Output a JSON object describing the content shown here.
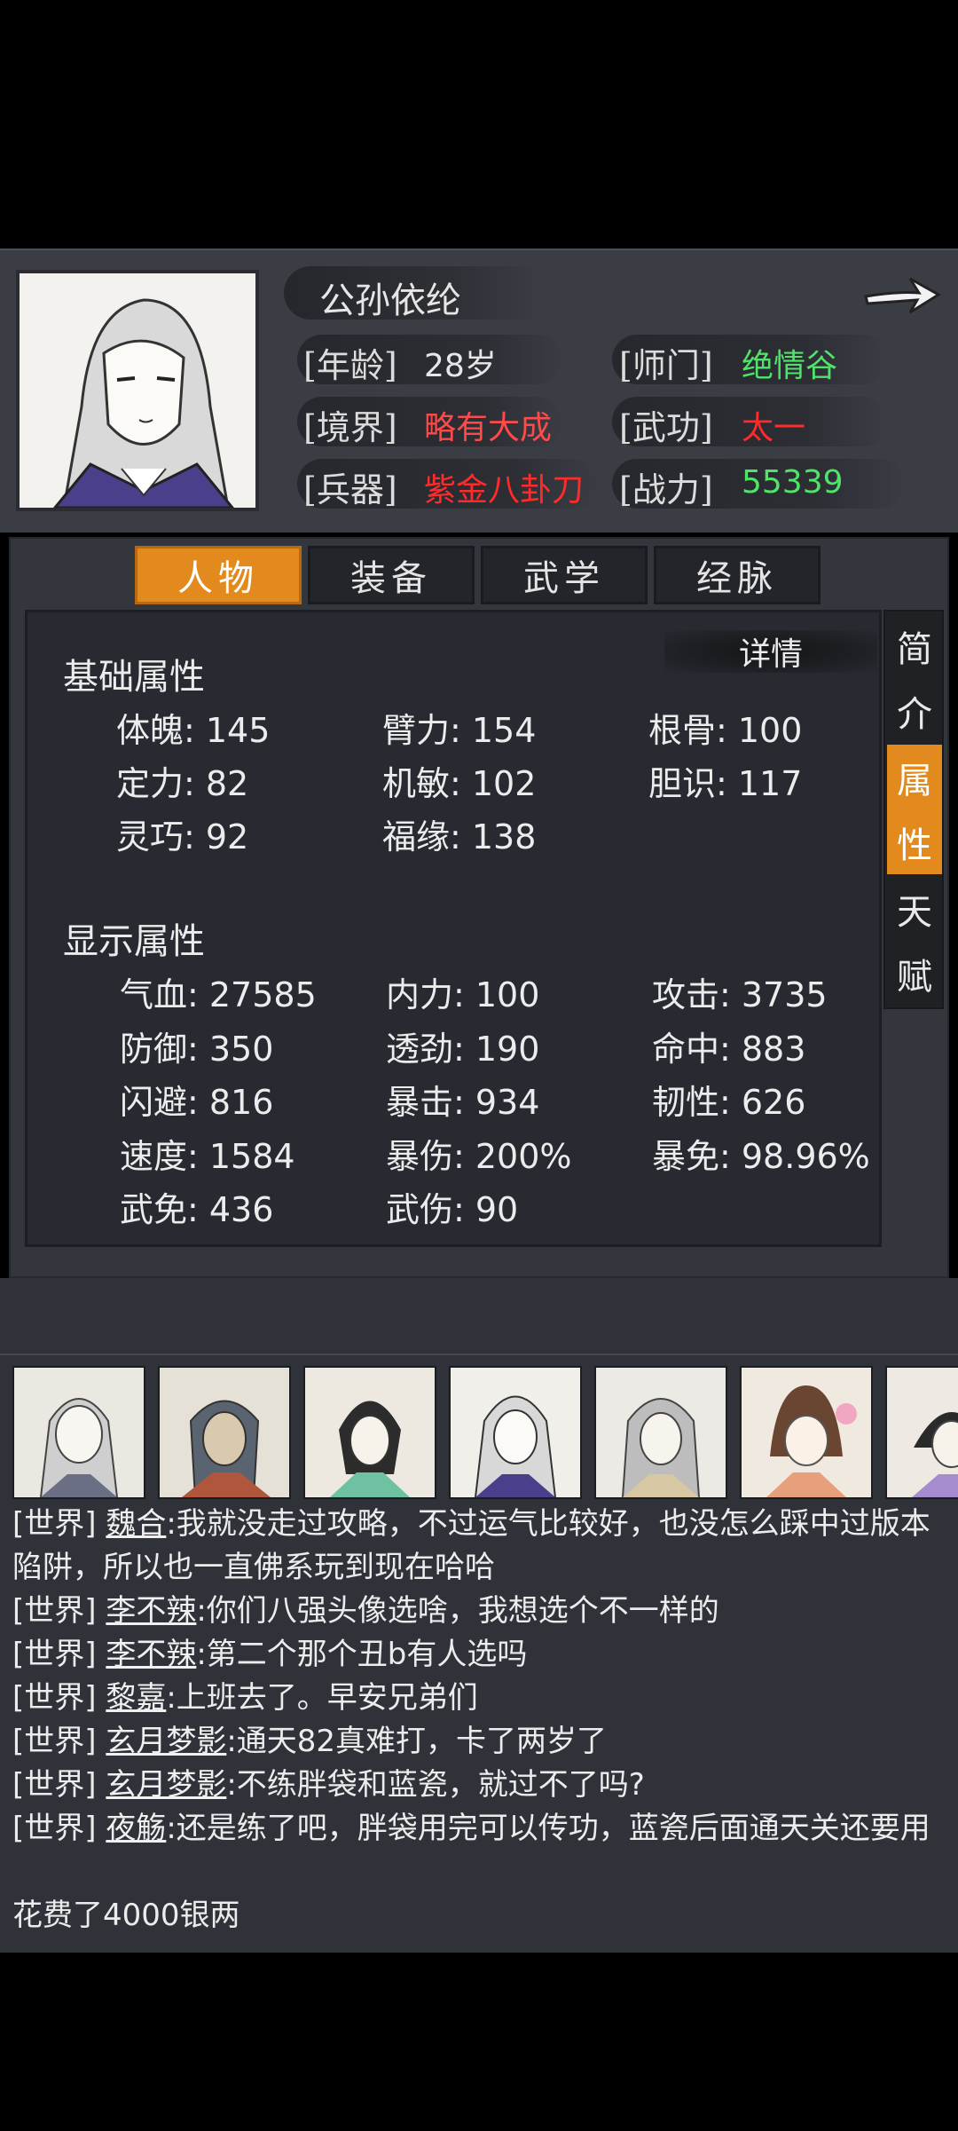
{
  "character": {
    "name": "公孙依纶",
    "rows": [
      {
        "label": "[年龄]",
        "value": "28岁",
        "color": "#e6e6e6"
      },
      {
        "label": "[境界]",
        "value": "略有大成",
        "color": "#ff4a4a"
      },
      {
        "label": "[兵器]",
        "value": "紫金八卦刀",
        "color": "#ff2a2a"
      }
    ],
    "rows_right": [
      {
        "label": "[师门]",
        "value": "绝情谷",
        "color": "#4fe36a"
      },
      {
        "label": "[武功]",
        "value": "太一",
        "color": "#ff2a2a"
      },
      {
        "label": "[战力]",
        "value": "55339",
        "color": "#4fe36a"
      }
    ]
  },
  "tabs": [
    "人物",
    "装备",
    "武学",
    "经脉"
  ],
  "side_tabs": [
    [
      "简",
      "介"
    ],
    [
      "属",
      "性"
    ],
    [
      "天",
      "赋"
    ]
  ],
  "detail_label": "详情",
  "base": {
    "title": "基础属性",
    "stats": [
      "体魄: 145",
      "臂力: 154",
      "根骨: 100",
      "定力: 82",
      "机敏: 102",
      "胆识: 117",
      "灵巧: 92",
      "福缘: 138"
    ]
  },
  "display": {
    "title": "显示属性",
    "stats": [
      "气血: 27585",
      "内力: 100",
      "攻击: 3735",
      "防御: 350",
      "透劲: 190",
      "命中: 883",
      "闪避: 816",
      "暴击: 934",
      "韧性: 626",
      "速度: 1584",
      "暴伤: 200%",
      "暴免: 98.96%",
      "武免: 436",
      "武伤: 90"
    ]
  },
  "chat": {
    "messages": [
      {
        "channel": "[世界]",
        "who": "魏合",
        "text": ":我就没走过攻略，不过运气比较好，也没怎么踩中过版本陷阱，所以也一直佛系玩到现在哈哈"
      },
      {
        "channel": "[世界]",
        "who": "李不辣",
        "text": ":你们八强头像选啥，我想选个不一样的"
      },
      {
        "channel": "[世界]",
        "who": "李不辣",
        "text": ":第二个那个丑b有人选吗"
      },
      {
        "channel": "[世界]",
        "who": "黎嘉",
        "text": ":上班去了。早安兄弟们"
      },
      {
        "channel": "[世界]",
        "who": "玄月梦影",
        "text": ":通天82真难打，卡了两岁了"
      },
      {
        "channel": "[世界]",
        "who": "玄月梦影",
        "text": ":不练胖袋和蓝瓷，就过不了吗?"
      },
      {
        "channel": "[世界]",
        "who": "夜觞",
        "text": ":还是练了吧，胖袋用完可以传功，蓝瓷后面通天关还要用"
      },
      {
        "channel": "",
        "who": "",
        "text": "花费了4000银两"
      }
    ]
  },
  "colors": {
    "accent": "#e28a1e",
    "green": "#4fe36a",
    "red": "#ff2a2a"
  }
}
